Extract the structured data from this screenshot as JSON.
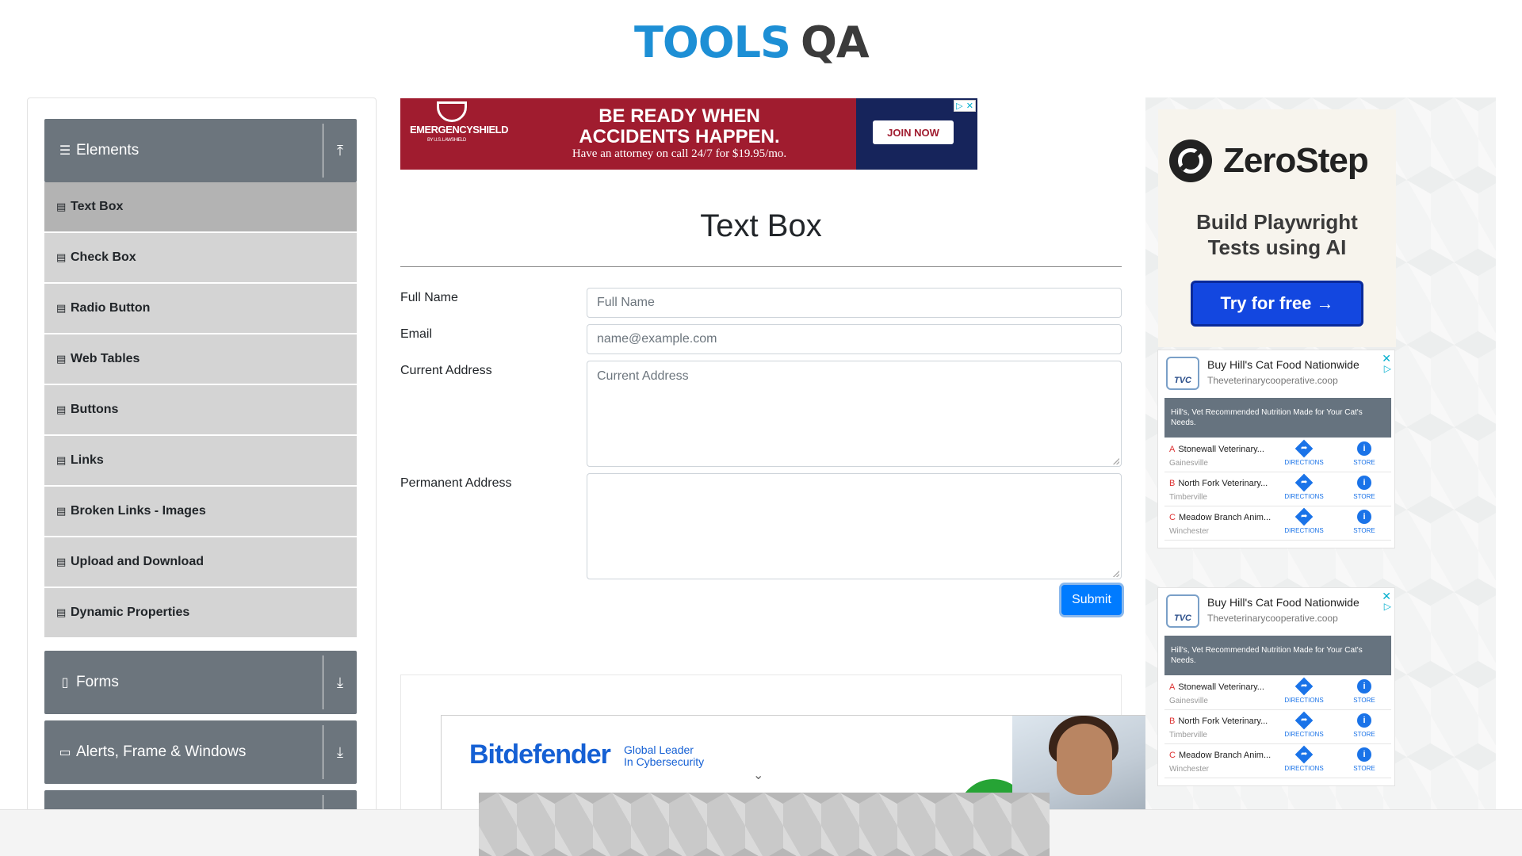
{
  "header": {
    "logo_tools": "TOOLS",
    "logo_qa": "QA"
  },
  "sidebar": {
    "groups": [
      {
        "label": "Elements",
        "icon": "hamburger-icon",
        "arrow": "upload-icon"
      },
      {
        "label": "Forms",
        "icon": "document-icon",
        "arrow": "download-icon"
      },
      {
        "label": "Alerts, Frame & Windows",
        "icon": "window-icon",
        "arrow": "download-icon"
      }
    ],
    "items": [
      {
        "label": "Text Box",
        "active": true
      },
      {
        "label": "Check Box"
      },
      {
        "label": "Radio Button"
      },
      {
        "label": "Web Tables"
      },
      {
        "label": "Buttons"
      },
      {
        "label": "Links"
      },
      {
        "label": "Broken Links - Images"
      },
      {
        "label": "Upload and Download"
      },
      {
        "label": "Dynamic Properties"
      }
    ]
  },
  "top_ad": {
    "brand": "EMERGENCYSHIELD",
    "brand_sub": "BY U.S. LAWSHIELD",
    "headline_1": "BE READY WHEN",
    "headline_2": "ACCIDENTS HAPPEN.",
    "subline": "Have an attorney on call 24/7 for $19.95/mo.",
    "cta": "JOIN NOW"
  },
  "form": {
    "title": "Text Box",
    "full_name_label": "Full Name",
    "full_name_placeholder": "Full Name",
    "email_label": "Email",
    "email_placeholder": "name@example.com",
    "current_address_label": "Current Address",
    "current_address_placeholder": "Current Address",
    "permanent_address_label": "Permanent Address",
    "permanent_address_placeholder": "",
    "submit_label": "Submit"
  },
  "bottom_ad": {
    "brand": "Bitdefender",
    "tagline_1": "Global Leader",
    "tagline_2": "In Cybersecurity"
  },
  "right_ads": {
    "zerostep": {
      "brand": "ZeroStep",
      "copy_1": "Build Playwright",
      "copy_2": "Tests using AI",
      "cta": "Try for free →"
    },
    "vet": {
      "logo": "TVC",
      "title": "Buy Hill's Cat Food Nationwide",
      "url": "Theveterinarycooperative.coop",
      "banner": "Hill's, Vet Recommended Nutrition Made for Your Cat's Needs.",
      "directions_label": "DIRECTIONS",
      "store_label": "STORE",
      "stores": [
        {
          "letter": "A",
          "name": "Stonewall Veterinary...",
          "city": "Gainesville"
        },
        {
          "letter": "B",
          "name": "North Fork Veterinary...",
          "city": "Timberville"
        },
        {
          "letter": "C",
          "name": "Meadow Branch Anim...",
          "city": "Winchester"
        }
      ]
    }
  },
  "colors": {
    "accent": "#007bff",
    "sidebar_group": "#6c757d",
    "sidebar_item": "#d4d4d4",
    "sidebar_item_active": "#b3b3b3",
    "logo_blue": "#1d8fd5"
  }
}
